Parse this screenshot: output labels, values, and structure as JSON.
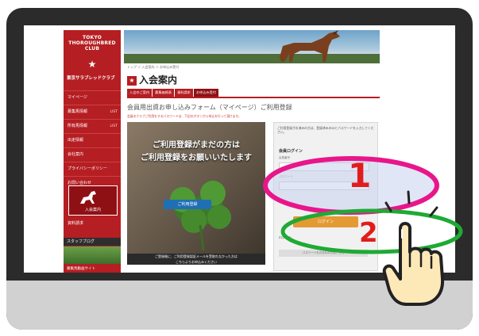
{
  "site": {
    "logo_lines": [
      "TOKYO",
      "THOROUGHBRED",
      "CLUB"
    ],
    "brand_jp": "東京サラブレッドクラブ",
    "nav": [
      {
        "label": "マイページ",
        "tag": ""
      },
      {
        "label": "募集馬情報",
        "tag": "LIST"
      },
      {
        "label": "所有馬情報",
        "tag": "LIST"
      },
      {
        "label": "出走情報",
        "tag": ""
      },
      {
        "label": "会社案内",
        "tag": ""
      },
      {
        "label": "プライバシーポリシー",
        "tag": ""
      },
      {
        "label": "お問い合わせ",
        "tag": ""
      }
    ],
    "join_label": "入会案内",
    "side_extra": "資料請求",
    "staff_blog": "スタッフブログ",
    "side_foot": "募集馬動画サイト",
    "breadcrumb": "トップ ＞ 入会案内 ＞ お申込み受付",
    "page_title": "入会案内",
    "tabs": [
      "入会のご案内",
      "募集価格表",
      "資料請求",
      "お申込み受付"
    ],
    "form_title": "会員用出資お申し込みフォーム（マイページ）ご利用登録",
    "note": "会員のクラブご利用をするパスワードは、下記のボタンから申込を行って頂けます。",
    "hero_line1": "ご利用登録がまだの方は",
    "hero_line2": "ご利用登録をお願いいたします",
    "hero_button": "ご利用登録",
    "hero_foot_1": "ご登録後に、ご利用登録認証メールを受取れなかった方は",
    "hero_foot_2": "こちらよりお申込みください",
    "login_info": "ご利用登録がお済みの方は、登録済みのIDとパスワードを入力してください。",
    "login_title": "会員ログイン",
    "id_label": "会員番号",
    "pw_label": "パスワード",
    "login_button": "ログイン",
    "login_sub": "ログイン",
    "login_sub2": "パスワードをお忘れの方はこちら"
  },
  "overlay": {
    "step1": "1",
    "step2": "2",
    "colors": {
      "magenta": "#e8168a",
      "green": "#1eaa34",
      "red": "#e21c1c"
    }
  }
}
